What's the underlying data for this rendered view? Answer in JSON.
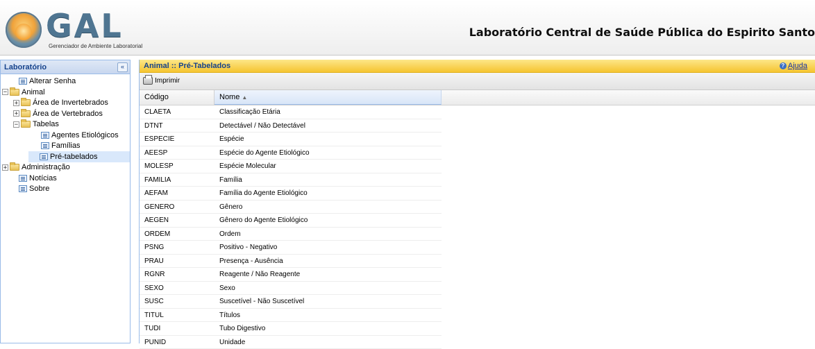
{
  "header": {
    "logo_text": "GAL",
    "logo_subtitle": "Gerenciador de Ambiente Laboratorial",
    "title": "Laboratório Central de Saúde Pública do Espirito Santo"
  },
  "sidebar": {
    "title": "Laboratório",
    "collapse_label": "«",
    "items": [
      {
        "label": "Alterar Senha",
        "type": "leaf",
        "level": 0
      },
      {
        "label": "Animal",
        "type": "folder",
        "level": 0,
        "expanded": true
      },
      {
        "label": "Área de Invertebrados",
        "type": "folder",
        "level": 1,
        "expanded": false
      },
      {
        "label": "Área de Vertebrados",
        "type": "folder",
        "level": 1,
        "expanded": false
      },
      {
        "label": "Tabelas",
        "type": "folder",
        "level": 1,
        "expanded": true
      },
      {
        "label": "Agentes Etiológicos",
        "type": "leaf",
        "level": 2
      },
      {
        "label": "Famílias",
        "type": "leaf",
        "level": 2
      },
      {
        "label": "Pré-tabelados",
        "type": "leaf",
        "level": 2,
        "selected": true
      },
      {
        "label": "Administração",
        "type": "folder",
        "level": 0,
        "expanded": false
      },
      {
        "label": "Notícias",
        "type": "leaf",
        "level": 0
      },
      {
        "label": "Sobre",
        "type": "leaf",
        "level": 0
      }
    ]
  },
  "main": {
    "title": "Animal :: Pré-Tabelados",
    "help_label": "Ajuda",
    "toolbar": {
      "print_label": "Imprimir"
    },
    "grid": {
      "columns": [
        "Código",
        "Nome"
      ],
      "sort_indicator": "▲",
      "rows": [
        {
          "code": "CLAETA",
          "name": "Classificação Etária"
        },
        {
          "code": "DTNT",
          "name": "Detectável / Não Detectável"
        },
        {
          "code": "ESPECIE",
          "name": "Espécie"
        },
        {
          "code": "AEESP",
          "name": "Espécie do Agente Etiológico"
        },
        {
          "code": "MOLESP",
          "name": "Espécie Molecular"
        },
        {
          "code": "FAMILIA",
          "name": "Família"
        },
        {
          "code": "AEFAM",
          "name": "Família do Agente Etiológico"
        },
        {
          "code": "GENERO",
          "name": "Gênero"
        },
        {
          "code": "AEGEN",
          "name": "Gênero do Agente Etiológico"
        },
        {
          "code": "ORDEM",
          "name": "Ordem"
        },
        {
          "code": "PSNG",
          "name": "Positivo - Negativo"
        },
        {
          "code": "PRAU",
          "name": "Presença - Ausência"
        },
        {
          "code": "RGNR",
          "name": "Reagente / Não Reagente"
        },
        {
          "code": "SEXO",
          "name": "Sexo"
        },
        {
          "code": "SUSC",
          "name": "Suscetível - Não Suscetível"
        },
        {
          "code": "TITUL",
          "name": "Títulos"
        },
        {
          "code": "TUDI",
          "name": "Tubo Digestivo"
        },
        {
          "code": "PUNID",
          "name": "Unidade"
        }
      ]
    }
  },
  "colors": {
    "panel_header_blue": "#15428b",
    "title_bar_yellow": "#f5c430",
    "sidebar_border": "#99bbe8",
    "selected_row": "#d9e8fb"
  }
}
